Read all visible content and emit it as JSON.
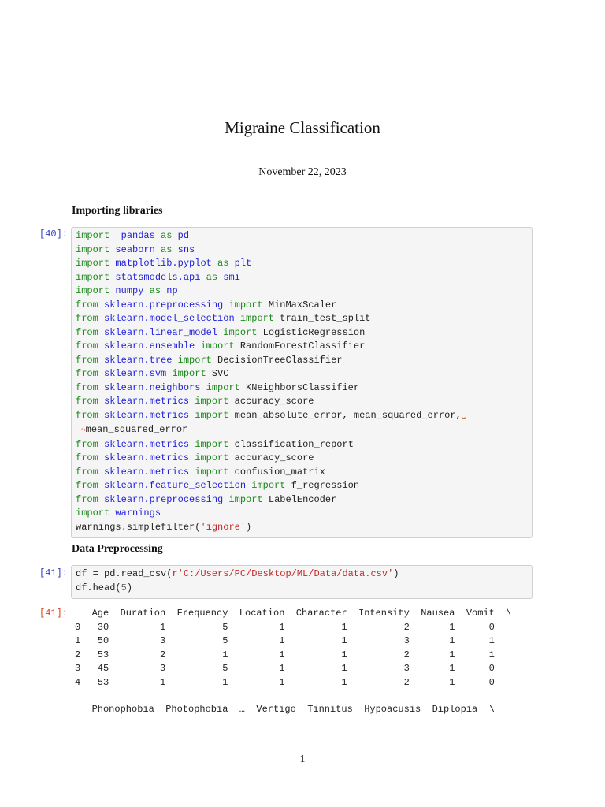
{
  "document": {
    "title": "Migraine Classification",
    "date": "November 22, 2023",
    "page_number": "1"
  },
  "sections": [
    {
      "heading": "Importing libraries"
    },
    {
      "heading": "Data Preprocessing"
    }
  ],
  "cells": [
    {
      "prompt": "[40]:",
      "lines": [
        [
          [
            "kw",
            "import"
          ],
          [
            "",
            "  "
          ],
          [
            "mod",
            "pandas"
          ],
          [
            "",
            " "
          ],
          [
            "kw",
            "as"
          ],
          [
            "",
            " "
          ],
          [
            "mod",
            "pd"
          ]
        ],
        [
          [
            "kw",
            "import"
          ],
          [
            "",
            " "
          ],
          [
            "mod",
            "seaborn"
          ],
          [
            "",
            " "
          ],
          [
            "kw",
            "as"
          ],
          [
            "",
            " "
          ],
          [
            "mod",
            "sns"
          ]
        ],
        [
          [
            "kw",
            "import"
          ],
          [
            "",
            " "
          ],
          [
            "mod",
            "matplotlib.pyplot"
          ],
          [
            "",
            " "
          ],
          [
            "kw",
            "as"
          ],
          [
            "",
            " "
          ],
          [
            "mod",
            "plt"
          ]
        ],
        [
          [
            "kw",
            "import"
          ],
          [
            "",
            " "
          ],
          [
            "mod",
            "statsmodels.api"
          ],
          [
            "",
            " "
          ],
          [
            "kw",
            "as"
          ],
          [
            "",
            " "
          ],
          [
            "mod",
            "smi"
          ]
        ],
        [
          [
            "kw",
            "import"
          ],
          [
            "",
            " "
          ],
          [
            "mod",
            "numpy"
          ],
          [
            "",
            " "
          ],
          [
            "kw",
            "as"
          ],
          [
            "",
            " "
          ],
          [
            "mod",
            "np"
          ]
        ],
        [
          [
            "kw",
            "from"
          ],
          [
            "",
            " "
          ],
          [
            "mod",
            "sklearn.preprocessing"
          ],
          [
            "",
            " "
          ],
          [
            "kw",
            "import"
          ],
          [
            "",
            " MinMaxScaler"
          ]
        ],
        [
          [
            "kw",
            "from"
          ],
          [
            "",
            " "
          ],
          [
            "mod",
            "sklearn.model_selection"
          ],
          [
            "",
            " "
          ],
          [
            "kw",
            "import"
          ],
          [
            "",
            " train_test_split"
          ]
        ],
        [
          [
            "kw",
            "from"
          ],
          [
            "",
            " "
          ],
          [
            "mod",
            "sklearn.linear_model"
          ],
          [
            "",
            " "
          ],
          [
            "kw",
            "import"
          ],
          [
            "",
            " LogisticRegression"
          ]
        ],
        [
          [
            "kw",
            "from"
          ],
          [
            "",
            " "
          ],
          [
            "mod",
            "sklearn.ensemble"
          ],
          [
            "",
            " "
          ],
          [
            "kw",
            "import"
          ],
          [
            "",
            " RandomForestClassifier"
          ]
        ],
        [
          [
            "kw",
            "from"
          ],
          [
            "",
            " "
          ],
          [
            "mod",
            "sklearn.tree"
          ],
          [
            "",
            " "
          ],
          [
            "kw",
            "import"
          ],
          [
            "",
            " DecisionTreeClassifier"
          ]
        ],
        [
          [
            "kw",
            "from"
          ],
          [
            "",
            " "
          ],
          [
            "mod",
            "sklearn.svm"
          ],
          [
            "",
            " "
          ],
          [
            "kw",
            "import"
          ],
          [
            "",
            " SVC"
          ]
        ],
        [
          [
            "kw",
            "from"
          ],
          [
            "",
            " "
          ],
          [
            "mod",
            "sklearn.neighbors"
          ],
          [
            "",
            " "
          ],
          [
            "kw",
            "import"
          ],
          [
            "",
            " KNeighborsClassifier"
          ]
        ],
        [
          [
            "kw",
            "from"
          ],
          [
            "",
            " "
          ],
          [
            "mod",
            "sklearn.metrics"
          ],
          [
            "",
            " "
          ],
          [
            "kw",
            "import"
          ],
          [
            "",
            " accuracy_score"
          ]
        ],
        [
          [
            "kw",
            "from"
          ],
          [
            "",
            " "
          ],
          [
            "mod",
            "sklearn.metrics"
          ],
          [
            "",
            " "
          ],
          [
            "kw",
            "import"
          ],
          [
            "",
            " mean_absolute_error, mean_squared_error,"
          ],
          [
            "cont",
            "␣"
          ]
        ],
        [
          [
            "",
            " "
          ],
          [
            "cont",
            "↪"
          ],
          [
            "",
            "mean_squared_error"
          ]
        ],
        [
          [
            "kw",
            "from"
          ],
          [
            "",
            " "
          ],
          [
            "mod",
            "sklearn.metrics"
          ],
          [
            "",
            " "
          ],
          [
            "kw",
            "import"
          ],
          [
            "",
            " classification_report"
          ]
        ],
        [
          [
            "kw",
            "from"
          ],
          [
            "",
            " "
          ],
          [
            "mod",
            "sklearn.metrics"
          ],
          [
            "",
            " "
          ],
          [
            "kw",
            "import"
          ],
          [
            "",
            " accuracy_score"
          ]
        ],
        [
          [
            "kw",
            "from"
          ],
          [
            "",
            " "
          ],
          [
            "mod",
            "sklearn.metrics"
          ],
          [
            "",
            " "
          ],
          [
            "kw",
            "import"
          ],
          [
            "",
            " confusion_matrix"
          ]
        ],
        [
          [
            "kw",
            "from"
          ],
          [
            "",
            " "
          ],
          [
            "mod",
            "sklearn.feature_selection"
          ],
          [
            "",
            " "
          ],
          [
            "kw",
            "import"
          ],
          [
            "",
            " f_regression"
          ]
        ],
        [
          [
            "kw",
            "from"
          ],
          [
            "",
            " "
          ],
          [
            "mod",
            "sklearn.preprocessing"
          ],
          [
            "",
            " "
          ],
          [
            "kw",
            "import"
          ],
          [
            "",
            " LabelEncoder"
          ]
        ],
        [
          [
            "kw",
            "import"
          ],
          [
            "",
            " "
          ],
          [
            "mod",
            "warnings"
          ]
        ],
        [
          [
            "",
            "warnings.simplefilter("
          ],
          [
            "str",
            "'ignore'"
          ],
          [
            "",
            ")"
          ]
        ]
      ]
    },
    {
      "prompt": "[41]:",
      "lines": [
        [
          [
            "",
            "df = pd.read_csv("
          ],
          [
            "str",
            "r'C:/Users/PC/Desktop/ML/Data/data.csv'"
          ],
          [
            "",
            ")"
          ]
        ],
        [
          [
            "",
            "df.head("
          ],
          [
            "num",
            "5"
          ],
          [
            "",
            ")"
          ]
        ]
      ]
    }
  ],
  "output": {
    "prompt": "[41]:",
    "header1": [
      "",
      "Age",
      "Duration",
      "Frequency",
      "Location",
      "Character",
      "Intensity",
      "Nausea",
      "Vomit",
      "\\"
    ],
    "rows": [
      [
        "0",
        "30",
        "1",
        "5",
        "1",
        "1",
        "2",
        "1",
        "0"
      ],
      [
        "1",
        "50",
        "3",
        "5",
        "1",
        "1",
        "3",
        "1",
        "1"
      ],
      [
        "2",
        "53",
        "2",
        "1",
        "1",
        "1",
        "2",
        "1",
        "1"
      ],
      [
        "3",
        "45",
        "3",
        "5",
        "1",
        "1",
        "3",
        "1",
        "0"
      ],
      [
        "4",
        "53",
        "1",
        "1",
        "1",
        "1",
        "2",
        "1",
        "0"
      ]
    ],
    "header2": [
      "",
      "Phonophobia",
      "Photophobia",
      "…",
      "Vertigo",
      "Tinnitus",
      "Hypoacusis",
      "Diplopia",
      "\\"
    ]
  }
}
